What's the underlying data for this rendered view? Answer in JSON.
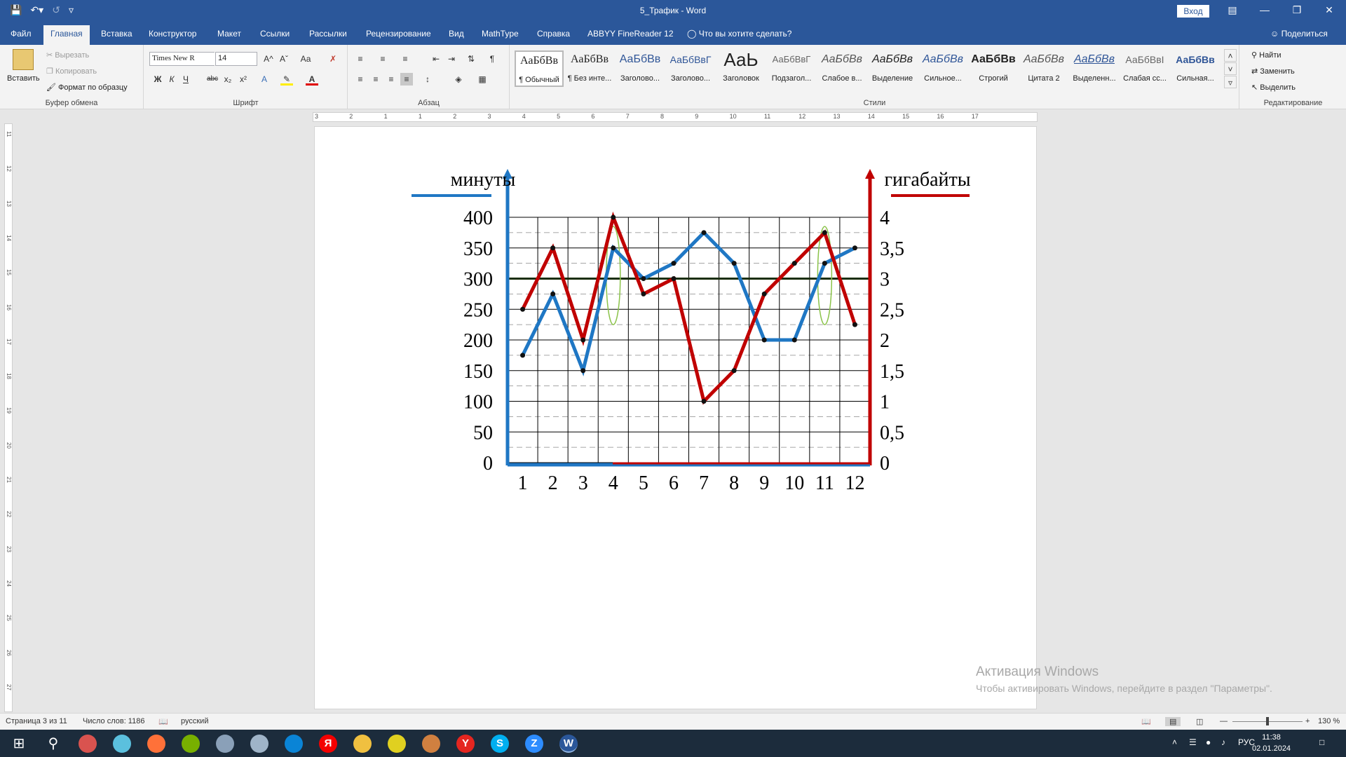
{
  "window": {
    "title": "5_Трафик  -  Word",
    "login_label": "Вход"
  },
  "qat": {
    "save_icon": "save-icon",
    "undo_icon": "undo-icon",
    "redo_icon": "redo-icon",
    "customize_icon": "customize-icon"
  },
  "tabs": [
    {
      "label": "Файл"
    },
    {
      "label": "Главная"
    },
    {
      "label": "Вставка"
    },
    {
      "label": "Конструктор"
    },
    {
      "label": "Макет"
    },
    {
      "label": "Ссылки"
    },
    {
      "label": "Рассылки"
    },
    {
      "label": "Рецензирование"
    },
    {
      "label": "Вид"
    },
    {
      "label": "MathType"
    },
    {
      "label": "Справка"
    },
    {
      "label": "ABBYY FineReader 12"
    }
  ],
  "tell_me": "Что вы хотите сделать?",
  "share_label": "Поделиться",
  "ribbon": {
    "clipboard": {
      "paste": "Вставить",
      "cut": "Вырезать",
      "copy": "Копировать",
      "format_painter": "Формат по образцу",
      "group": "Буфер обмена"
    },
    "font": {
      "family": "Times New R",
      "size": "14",
      "group": "Шрифт",
      "bold": "Ж",
      "italic": "К",
      "underline": "Ч",
      "strike": "abc",
      "sub": "x₂",
      "sup": "x²",
      "grow": "A^",
      "shrink": "Aˇ",
      "case": "Аа"
    },
    "paragraph": {
      "group": "Абзац",
      "pilcrow": "¶"
    },
    "styles": {
      "group": "Стили",
      "items": [
        {
          "sample": "АаБбВв",
          "name": "¶ Обычный"
        },
        {
          "sample": "АаБбВв",
          "name": "¶ Без инте..."
        },
        {
          "sample": "АаБбВв",
          "name": "Заголово..."
        },
        {
          "sample": "АаБбВвГ",
          "name": "Заголово..."
        },
        {
          "sample": "АаЬ",
          "name": "Заголовок"
        },
        {
          "sample": "АаБбВвГ",
          "name": "Подзагол..."
        },
        {
          "sample": "АаБбВв",
          "name": "Слабое в..."
        },
        {
          "sample": "АаБбВв",
          "name": "Выделение"
        },
        {
          "sample": "АаБбВв",
          "name": "Сильное..."
        },
        {
          "sample": "АаБбВв",
          "name": "Строгий"
        },
        {
          "sample": "АаБбВв",
          "name": "Цитата 2"
        },
        {
          "sample": "АаБбВв",
          "name": "Выделенн..."
        },
        {
          "sample": "АаБбВвI",
          "name": "Слабая сс..."
        },
        {
          "sample": "АаБбВв",
          "name": "Сильная..."
        }
      ]
    },
    "editing": {
      "find": "Найти",
      "replace": "Заменить",
      "select": "Выделить",
      "group": "Редактирование"
    }
  },
  "ruler": {
    "labels": [
      "3",
      "2",
      "1",
      "1",
      "2",
      "3",
      "4",
      "5",
      "6",
      "7",
      "8",
      "9",
      "10",
      "11",
      "12",
      "13",
      "14",
      "15",
      "16",
      "17"
    ]
  },
  "vruler": {
    "labels": [
      "11",
      "12",
      "13",
      "14",
      "15",
      "16",
      "17",
      "18",
      "19",
      "20",
      "21",
      "22",
      "23",
      "24",
      "25",
      "26",
      "27"
    ]
  },
  "chart_data": {
    "type": "line",
    "left_axis_label": "минуты",
    "right_axis_label": "гигабайты",
    "categories": [
      "1",
      "2",
      "3",
      "4",
      "5",
      "6",
      "7",
      "8",
      "9",
      "10",
      "11",
      "12"
    ],
    "left_ticks": [
      "0",
      "50",
      "100",
      "150",
      "200",
      "250",
      "300",
      "350",
      "400"
    ],
    "right_ticks": [
      "0",
      "0,5",
      "1",
      "1,5",
      "2",
      "2,5",
      "3",
      "3,5",
      "4"
    ],
    "ylim_left": [
      0,
      400
    ],
    "ylim_right": [
      0,
      4
    ],
    "reference_line": 300,
    "highlighted_categories": [
      "4",
      "11"
    ],
    "series": [
      {
        "axis": "left",
        "color": "#1f77c4",
        "values": [
          175,
          275,
          150,
          350,
          300,
          325,
          375,
          325,
          200,
          200,
          325,
          350
        ]
      },
      {
        "axis": "right",
        "color": "#c00000",
        "values": [
          2.5,
          3.5,
          2,
          4,
          2.75,
          3,
          1,
          1.5,
          2.75,
          3.25,
          3.75,
          2.25
        ]
      }
    ],
    "grid": true
  },
  "activation": {
    "title": "Активация Windows",
    "text": "Чтобы активировать Windows, перейдите в раздел \"Параметры\"."
  },
  "status": {
    "page": "Страница 3 из 11",
    "words": "Число слов: 1186",
    "lang": "русский",
    "zoom": "130 %"
  },
  "clock": {
    "time": "11:38",
    "date": "02.01.2024",
    "lang": "РУС"
  },
  "taskbar": {
    "icons": [
      "windows-icon",
      "search-icon",
      "browser-icon",
      "notepad-icon",
      "firefox-icon",
      "utorrent-icon",
      "paint-icon",
      "cloud-icon",
      "edge-icon",
      "yandex-icon",
      "explorer-icon",
      "maps-icon",
      "files-icon",
      "yandex-browser-icon",
      "skype-icon",
      "zoom-icon",
      "word-icon"
    ]
  }
}
